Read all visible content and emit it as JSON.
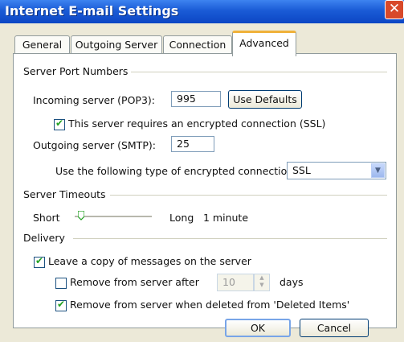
{
  "window": {
    "title": "Internet E-mail Settings",
    "close_glyph": "✕"
  },
  "tabs": [
    {
      "label": "General"
    },
    {
      "label": "Outgoing Server"
    },
    {
      "label": "Connection"
    },
    {
      "label": "Advanced",
      "active": true
    }
  ],
  "ports": {
    "group_label": "Server Port Numbers",
    "incoming_label": "Incoming server (POP3):",
    "incoming_value": "995",
    "use_defaults": "Use Defaults",
    "ssl_incoming_label": "This server requires an encrypted connection (SSL)",
    "ssl_incoming_checked": true,
    "outgoing_label": "Outgoing server (SMTP):",
    "outgoing_value": "25",
    "encryption_label": "Use the following type of encrypted connection:",
    "encryption_value": "SSL"
  },
  "timeouts": {
    "group_label": "Server Timeouts",
    "short_label": "Short",
    "long_label": "Long",
    "value_label": "1 minute",
    "level": 0.08
  },
  "delivery": {
    "group_label": "Delivery",
    "leave_copy_label": "Leave a copy of messages on the server",
    "leave_copy_checked": true,
    "remove_after_label": "Remove from server after",
    "remove_after_checked": false,
    "days_value": "10",
    "days_unit": "days",
    "remove_deleted_label": "Remove from server when deleted from 'Deleted Items'",
    "remove_deleted_checked": true
  },
  "buttons": {
    "ok": "OK",
    "cancel": "Cancel"
  },
  "icons": {
    "close": "close-icon",
    "dropdown": "chevron-down-icon",
    "spin_up": "spin-up-icon",
    "spin_down": "spin-down-icon",
    "slider": "slider-thumb-icon"
  }
}
